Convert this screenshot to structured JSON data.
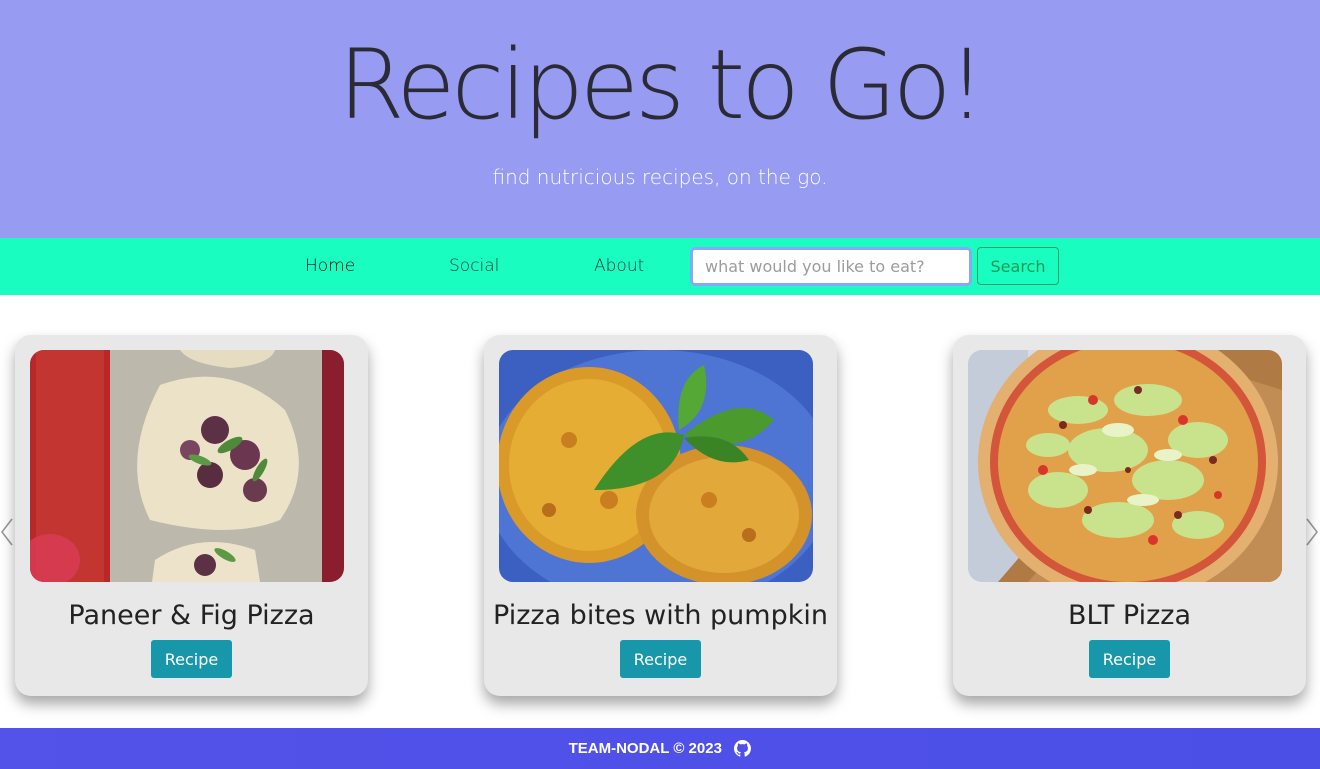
{
  "hero": {
    "title": "Recipes to Go!",
    "subtitle": "find nutricious recipes, on the go."
  },
  "nav": {
    "links": [
      {
        "label": "Home",
        "active": true
      },
      {
        "label": "Social",
        "active": false
      },
      {
        "label": "About",
        "active": false
      }
    ],
    "search_placeholder": "what would you like to eat?",
    "search_value": "",
    "search_button": "Search"
  },
  "carousel": {
    "prev_icon": "chevron-left-icon",
    "next_icon": "chevron-right-icon",
    "cards": [
      {
        "title": "Paneer & Fig Pizza",
        "button": "Recipe",
        "image": "paneer-fig-pizza-photo"
      },
      {
        "title": "Pizza bites with pumpkin",
        "button": "Recipe",
        "image": "pizza-bites-pumpkin-photo"
      },
      {
        "title": "BLT Pizza",
        "button": "Recipe",
        "image": "blt-pizza-photo"
      }
    ]
  },
  "footer": {
    "text": "TEAM-NODAL © 2023",
    "icon": "github-icon"
  },
  "colors": {
    "hero_bg": "#979bf2",
    "nav_bg": "#19fdc0",
    "card_bg": "#e8e8e8",
    "button_bg": "#1997aa",
    "footer_bg": "#5352e9"
  }
}
